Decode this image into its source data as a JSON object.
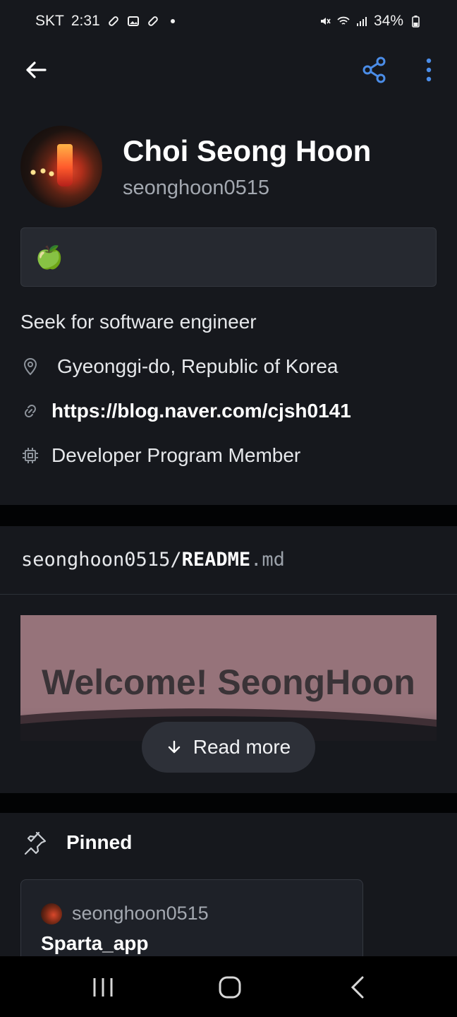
{
  "status_bar": {
    "carrier": "SKT",
    "time": "2:31",
    "battery": "34%"
  },
  "app_bar": {
    "accent_color": "#4b8de8",
    "icons": [
      "back-arrow-icon",
      "share-icon",
      "more-vertical-icon"
    ]
  },
  "profile": {
    "name": "Choi Seong Hoon",
    "login": "seonghoon0515",
    "status_emoji": "🍏",
    "bio": "Seek for software engineer",
    "location": "Gyeonggi-do, Republic of Korea",
    "website": "https://blog.naver.com/cjsh0141",
    "badge": "Developer Program Member"
  },
  "readme": {
    "owner": "seonghoon0515",
    "separator": "/",
    "file": "README",
    "ext": ".md",
    "banner_text": "Welcome! SeongHoon",
    "banner_color": "#96737a",
    "read_more": "Read more"
  },
  "pinned": {
    "title": "Pinned",
    "items": [
      {
        "owner": "seonghoon0515",
        "repo": "Sparta_app"
      }
    ]
  }
}
